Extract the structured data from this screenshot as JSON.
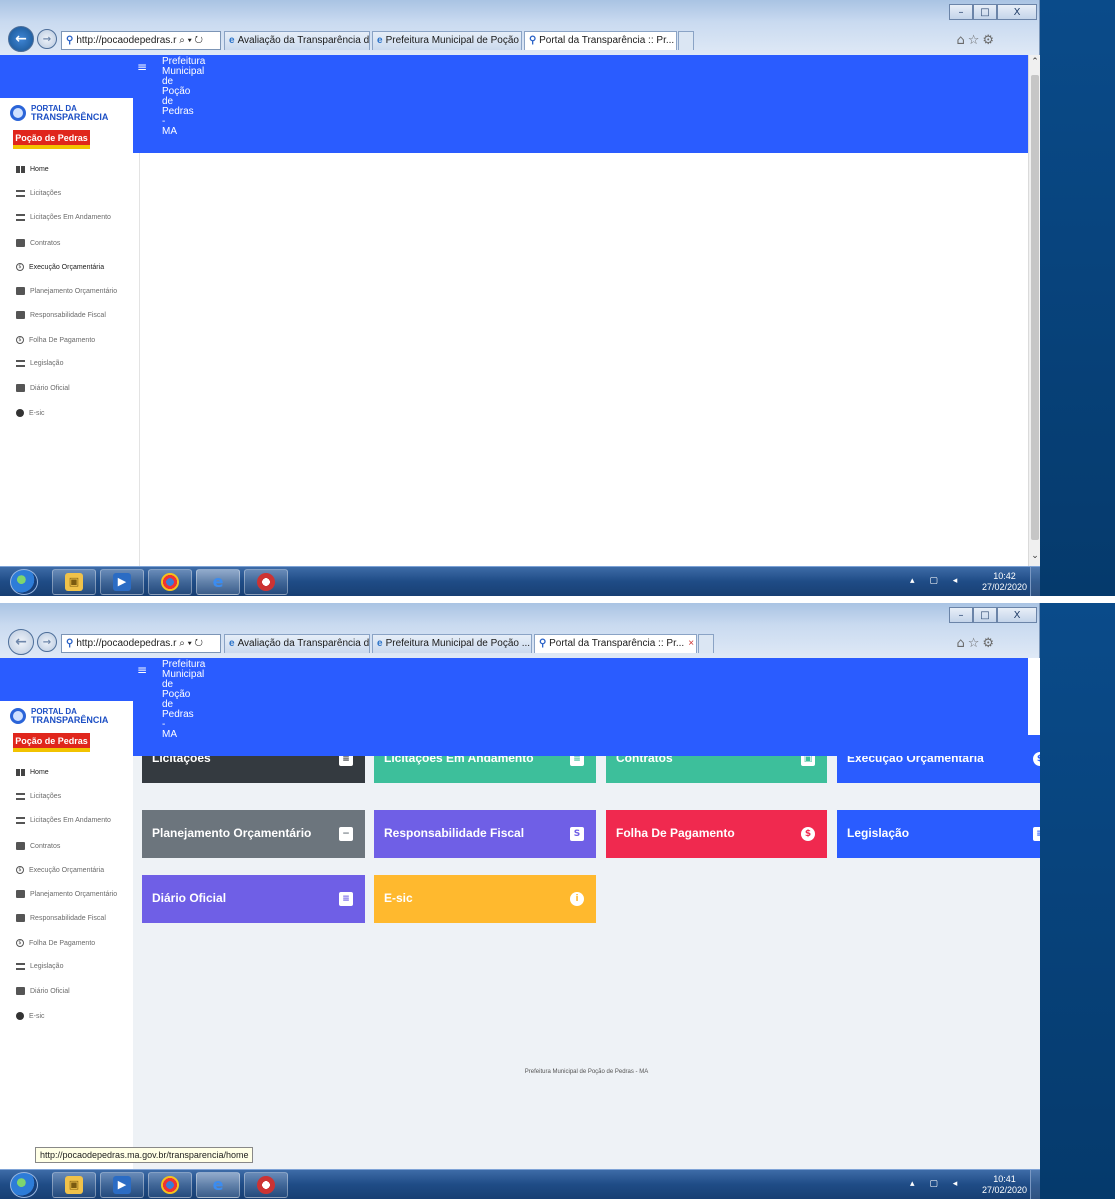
{
  "browser": {
    "address_text": "http://pocaodepedras.r",
    "address_suffix": "⌕ ▾ ↻",
    "tabs": [
      {
        "label": "Avaliação da Transparência do..."
      },
      {
        "label": "Prefeitura Municipal de Poção ..."
      },
      {
        "label": "Portal da Transparência :: Pr..."
      }
    ],
    "tab_close": "×",
    "window_buttons": [
      "–",
      "□",
      "X"
    ],
    "tools": "⌂☆⚙",
    "status_url": "http://pocaodepedras.ma.gov.br/transparencia/home"
  },
  "site": {
    "title_lines": "Prefeitura\nMunicipal\nde\nPoção\nde\nPedras\n-\nMA",
    "portal_line1": "PORTAL DA",
    "portal_line2": "TRANSPARÊNCIA",
    "city_logo": "Poção de Pedras",
    "hamburger": "≡"
  },
  "sidebar": {
    "items": [
      {
        "label": "Home",
        "icon": "grid-icon"
      },
      {
        "label": "Licitações",
        "icon": "list-icon"
      },
      {
        "label": "Licitações Em Andamento",
        "icon": "list-icon"
      },
      {
        "label": "Contratos",
        "icon": "books-icon"
      },
      {
        "label": "Execução Orçamentária",
        "icon": "dollar-circle-icon"
      },
      {
        "label": "Planejamento Orçamentário",
        "icon": "minus-box-icon"
      },
      {
        "label": "Responsabilidade Fiscal",
        "icon": "s-box-icon"
      },
      {
        "label": "Folha De Pagamento",
        "icon": "dollar-circle-icon"
      },
      {
        "label": "Legislação",
        "icon": "document-icon"
      },
      {
        "label": "Diário Oficial",
        "icon": "newspaper-icon"
      },
      {
        "label": "E-sic",
        "icon": "info-icon"
      }
    ]
  },
  "cards": {
    "row1": [
      {
        "label": "Licitações",
        "color": "#343a40"
      },
      {
        "label": "Licitações Em Andamento",
        "color": "#3dbf9b"
      },
      {
        "label": "Contratos",
        "color": "#3dbf9b"
      },
      {
        "label": "Execução Orçamentária",
        "color": "#2a5cff"
      }
    ],
    "row2": [
      {
        "label": "Planejamento Orçamentário",
        "color": "#6c757d",
        "icon": "−"
      },
      {
        "label": "Responsabilidade Fiscal",
        "color": "#6f5fe6",
        "icon": "S"
      },
      {
        "label": "Folha De Pagamento",
        "color": "#f0294f",
        "icon": "$"
      },
      {
        "label": "Legislação",
        "color": "#2a5cff",
        "icon": "≡"
      }
    ],
    "row3": [
      {
        "label": "Diário Oficial",
        "color": "#6f5fe6",
        "icon": "≡"
      },
      {
        "label": "E-sic",
        "color": "#ffb92e",
        "icon": "i"
      }
    ]
  },
  "footer": "Prefeitura Municipal de Poção de Pedras - MA",
  "taskbar": {
    "clock_top": {
      "time": "10:42",
      "date": "27/02/2020"
    },
    "clock_bottom": {
      "time": "10:41",
      "date": "27/02/2020"
    },
    "tray_icons": "▴ ▢ ◂"
  }
}
